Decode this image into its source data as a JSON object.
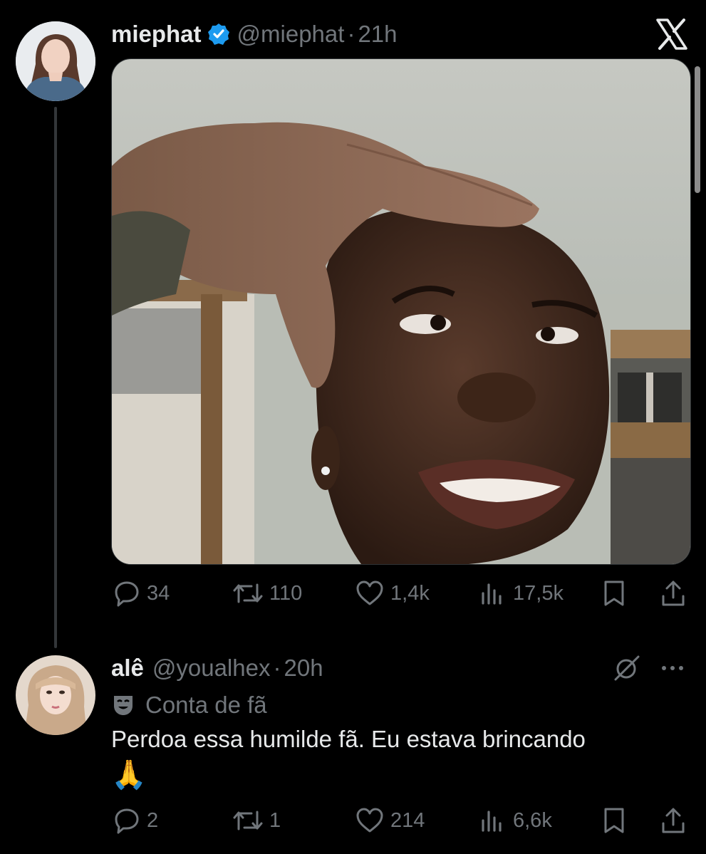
{
  "tweet": {
    "display_name": "miephat",
    "handle": "@miephat",
    "separator": "·",
    "time": "21h",
    "verified": true,
    "media_alt": "man-reaction-photo",
    "replies": "34",
    "retweets": "110",
    "likes": "1,4k",
    "views": "17,5k"
  },
  "reply": {
    "display_name": "alê",
    "handle": "@youalhex",
    "separator": "·",
    "time": "20h",
    "badge_icon": "🤡",
    "badge_label": "Conta de fã",
    "text": "Perdoa essa humilde fã. Eu estava brincando",
    "emoji": "🙏",
    "replies": "2",
    "retweets": "1",
    "likes": "214",
    "views": "6,6k"
  },
  "colors": {
    "background": "#000000",
    "text": "#e7e9ea",
    "muted": "#71767b",
    "verified": "#1d9bf0"
  }
}
